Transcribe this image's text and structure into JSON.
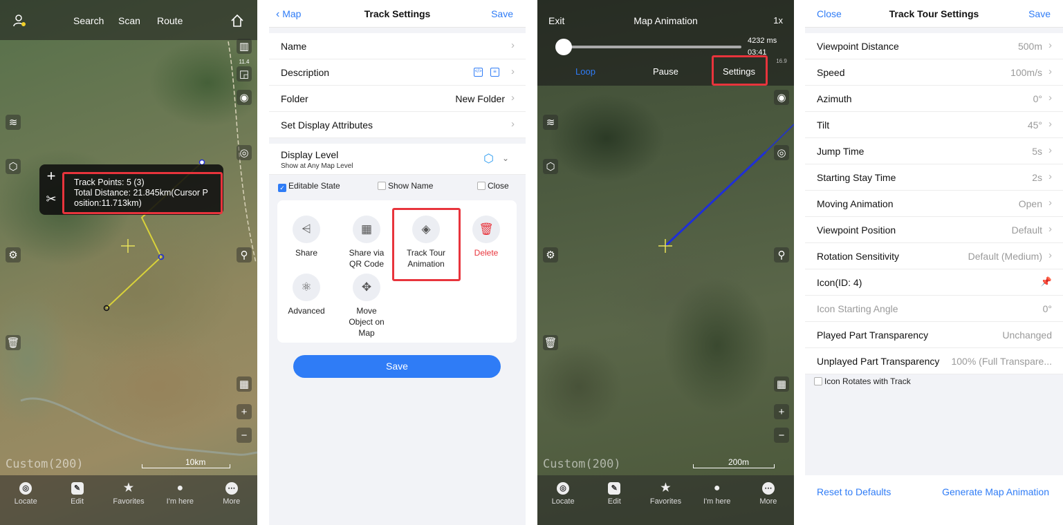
{
  "map_panel": {
    "nav": {
      "search": "Search",
      "scan": "Scan",
      "route": "Route"
    },
    "track_info": {
      "points": "Track Points: 5 (3)",
      "distance_line1": "Total Distance: 21.845km(Cursor P",
      "distance_line2": "osition:11.713km)"
    },
    "zoom_small": "11.4",
    "watermark": "Custom(200)",
    "scale": "10km",
    "bottom_nav": [
      "Locate",
      "Edit",
      "Favorites",
      "I'm here",
      "More"
    ]
  },
  "track_settings": {
    "header": {
      "back": "Map",
      "title": "Track Settings",
      "save": "Save"
    },
    "rows": {
      "name": "Name",
      "description": "Description",
      "folder": "Folder",
      "folder_value": "New Folder",
      "display_attrs": "Set Display Attributes",
      "display_level": "Display Level",
      "display_level_sub": "Show at Any Map Level"
    },
    "checks": {
      "editable": "Editable State",
      "show_name": "Show Name",
      "close": "Close"
    },
    "grid": {
      "share": "Share",
      "share_qr_1": "Share via",
      "share_qr_2": "QR Code",
      "tour_1": "Track Tour",
      "tour_2": "Animation",
      "delete": "Delete",
      "advanced": "Advanced",
      "move_1": "Move",
      "move_2": "Object on",
      "move_3": "Map"
    },
    "save_button": "Save"
  },
  "map_animation": {
    "header": {
      "exit": "Exit",
      "title": "Map Animation",
      "speed": "1x"
    },
    "time_ms": "4232 ms",
    "time_clock": "03:41",
    "slider_progress": 0.03,
    "controls": {
      "loop": "Loop",
      "pause": "Pause",
      "settings": "Settings"
    },
    "zoom_small": "16.9",
    "watermark": "Custom(200)",
    "scale": "200m",
    "bottom_nav": [
      "Locate",
      "Edit",
      "Favorites",
      "I'm here",
      "More"
    ]
  },
  "tour_settings": {
    "header": {
      "close": "Close",
      "title": "Track Tour Settings",
      "save": "Save"
    },
    "rows": [
      {
        "label": "Viewpoint Distance",
        "value": "500m"
      },
      {
        "label": "Speed",
        "value": "100m/s"
      },
      {
        "label": "Azimuth",
        "value": "0°"
      },
      {
        "label": "Tilt",
        "value": "45°"
      },
      {
        "label": "Jump Time",
        "value": "5s"
      },
      {
        "label": "Starting Stay Time",
        "value": "2s"
      },
      {
        "label": "Moving Animation",
        "value": "Open"
      },
      {
        "label": "Viewpoint Position",
        "value": "Default"
      },
      {
        "label": "Rotation Sensitivity",
        "value": "Default (Medium)"
      },
      {
        "label": "Icon(ID: 4)",
        "value": ""
      },
      {
        "label": "Icon Starting Angle",
        "value": "0°"
      },
      {
        "label": "Played Part Transparency",
        "value": "Unchanged"
      },
      {
        "label": "Unplayed Part Transparency",
        "value": "100% (Full Transpare..."
      }
    ],
    "checkbox": "Icon Rotates with Track",
    "footer": {
      "reset": "Reset to Defaults",
      "generate": "Generate Map Animation"
    }
  },
  "colors": {
    "accent": "#2f7cf6",
    "highlight": "#e8343c",
    "track_yellow": "#d9d23a",
    "track_blue": "#1f2fd6"
  }
}
